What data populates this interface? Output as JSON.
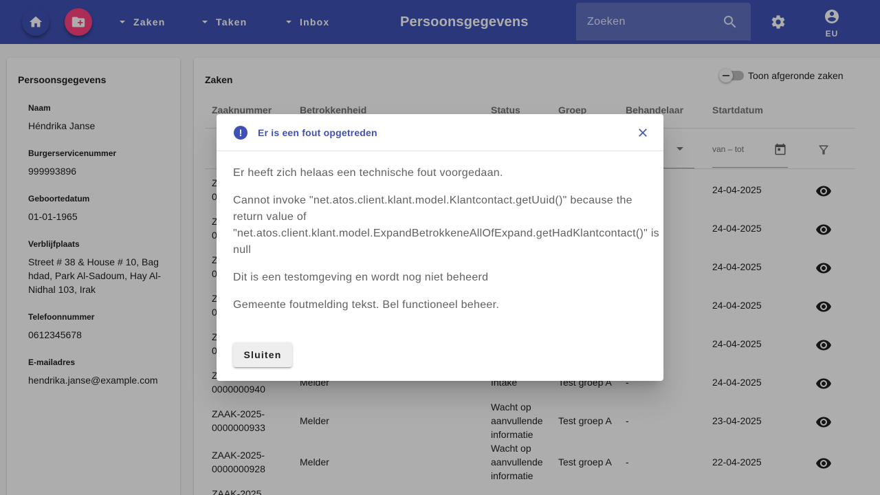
{
  "toolbar": {
    "home_icon": "home-icon",
    "new_folder_icon": "create-new-folder-icon",
    "menus": [
      "Zaken",
      "Taken",
      "Inbox"
    ],
    "title": "Persoonsgegevens",
    "search_placeholder": "Zoeken",
    "user_label": "EU",
    "accent_color": "#3f51b5",
    "fab_color": "#ff4081"
  },
  "person": {
    "title": "Persoonsgegevens",
    "fields": [
      {
        "label": "Naam",
        "value": "Héndrika Janse"
      },
      {
        "label": "Burgerservicenummer",
        "value": "999993896"
      },
      {
        "label": "Geboortedatum",
        "value": "01-01-1965"
      },
      {
        "label": "Verblijfplaats",
        "value": "Street # 38 & House # 10, Bag hdad, Park Al-Sadoum, Hay Al-Nidhal 103, Irak"
      },
      {
        "label": "Telefoonnummer",
        "value": "0612345678"
      },
      {
        "label": "E-mailadres",
        "value": "hendrika.janse@example.com"
      }
    ]
  },
  "zaken": {
    "title": "Zaken",
    "toggle_label": "Toon afgeronde zaken",
    "columns": [
      "Zaaknummer",
      "Betrokkenheid",
      "Status",
      "Groep",
      "Behandelaar",
      "Startdatum"
    ],
    "date_filter_placeholder": "van – tot",
    "rows": [
      {
        "zaaknummer_1": "Z",
        "zaaknummer_2": "0",
        "betrokkenheid": "",
        "status": "",
        "groep": "",
        "behandelaar": "",
        "startdatum": "24-04-2025"
      },
      {
        "zaaknummer_1": "Z",
        "zaaknummer_2": "0",
        "betrokkenheid": "",
        "status": "",
        "groep": "",
        "behandelaar": "",
        "startdatum": "24-04-2025"
      },
      {
        "zaaknummer_1": "Z",
        "zaaknummer_2": "0",
        "betrokkenheid": "",
        "status": "",
        "groep": "",
        "behandelaar": "",
        "startdatum": "24-04-2025"
      },
      {
        "zaaknummer_1": "Z",
        "zaaknummer_2": "0",
        "betrokkenheid": "",
        "status": "",
        "groep": "",
        "behandelaar": "",
        "startdatum": "24-04-2025"
      },
      {
        "zaaknummer_1": "Z",
        "zaaknummer_2": "0",
        "betrokkenheid": "",
        "status": "",
        "groep": "",
        "behandelaar": "",
        "startdatum": "24-04-2025"
      },
      {
        "zaaknummer_1": "Z",
        "zaaknummer_2": "0000000940",
        "betrokkenheid": "Melder",
        "status": "Intake",
        "groep": "Test groep A",
        "behandelaar": "-",
        "startdatum": "24-04-2025"
      },
      {
        "zaaknummer_1": "ZAAK-2025-",
        "zaaknummer_2": "0000000933",
        "betrokkenheid": "Melder",
        "status": "Wacht op aanvullende informatie",
        "groep": "Test groep A",
        "behandelaar": "-",
        "startdatum": "23-04-2025"
      },
      {
        "zaaknummer_1": "ZAAK-2025-",
        "zaaknummer_2": "0000000928",
        "betrokkenheid": "Melder",
        "status": "Wacht op aanvullende informatie",
        "groep": "Test groep A",
        "behandelaar": "-",
        "startdatum": "22-04-2025"
      },
      {
        "zaaknummer_1": "ZAAK-2025",
        "zaaknummer_2": "",
        "betrokkenheid": "",
        "status": "",
        "groep": "",
        "behandelaar": "",
        "startdatum": ""
      }
    ]
  },
  "dialog": {
    "title": "Er is een fout opgetreden",
    "paragraphs": [
      "Er heeft zich helaas een technische fout voorgedaan.",
      "Cannot invoke \"net.atos.client.klant.model.Klantcontact.getUuid()\" because the return value of \"net.atos.client.klant.model.ExpandBetrokkeneAllOfExpand.getHadKlantcontact()\" is null",
      "Dit is een testomgeving en wordt nog niet beheerd",
      "Gemeente foutmelding tekst. Bel functioneel beheer."
    ],
    "close_button": "Sluiten"
  }
}
